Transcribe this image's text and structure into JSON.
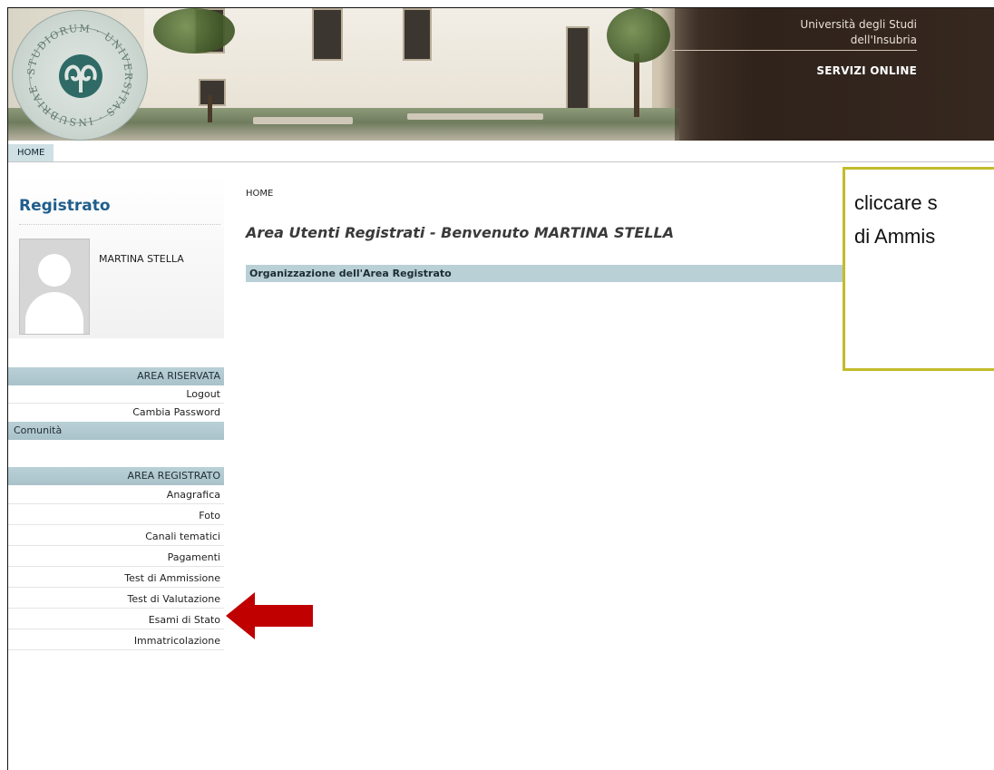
{
  "banner": {
    "university_line1": "Università degli Studi",
    "university_line2": "dell'Insubria",
    "service": "SERVIZI ONLINE",
    "seal_text": "STUDIORUM · UNIVERSITAS · INSUBRIAE ·"
  },
  "topnav": {
    "home_tab": "HOME"
  },
  "profile": {
    "role": "Registrato",
    "user_name": "MARTINA STELLA"
  },
  "sidebar": {
    "area_riservata": {
      "title": "AREA RISERVATA",
      "items": [
        "Logout",
        "Cambia Password"
      ]
    },
    "comunita": "Comunità",
    "area_registrato": {
      "title": "AREA REGISTRATO",
      "items": [
        "Anagrafica",
        "Foto",
        "Canali tematici",
        "Pagamenti",
        "Test di Ammissione",
        "Test di Valutazione",
        "Esami di Stato",
        "Immatricolazione"
      ]
    }
  },
  "main": {
    "breadcrumb": "HOME",
    "welcome": "Area Utenti Registrati - Benvenuto MARTINA STELLA",
    "section_bar": "Organizzazione dell'Area Registrato"
  },
  "callout": {
    "line1": "cliccare s",
    "line2": "di Ammis",
    "border_color": "#c2bc2a"
  },
  "arrow": {
    "color": "#c00000"
  }
}
